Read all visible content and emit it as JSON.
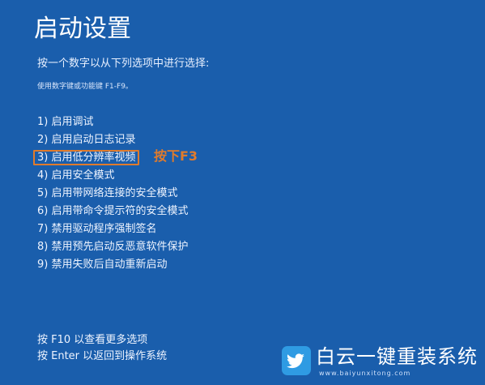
{
  "title": "启动设置",
  "instruction": "按一个数字以从下列选项中进行选择:",
  "hint": "使用数字键或功能键 F1-F9。",
  "options": [
    "1) 启用调试",
    "2) 启用启动日志记录",
    "3) 启用低分辨率视频",
    "4) 启用安全模式",
    "5) 启用带网络连接的安全模式",
    "6) 启用带命令提示符的安全模式",
    "7) 禁用驱动程序强制签名",
    "8) 禁用预先启动反恶意软件保护",
    "9) 禁用失败后自动重新启动"
  ],
  "highlighted_option": 3,
  "annotation": "按下F3",
  "footer": {
    "more_options": "按 F10 以查看更多选项",
    "return": "按 Enter 以返回到操作系统"
  },
  "watermark": {
    "name": "白云一键重装系统",
    "url": "www.baiyunxitong.com",
    "icon": "bird-icon"
  },
  "colors": {
    "background": "#1a5eac",
    "highlight": "#e07b2c",
    "text": "#eef4ff",
    "logo": "#2f9be3"
  }
}
